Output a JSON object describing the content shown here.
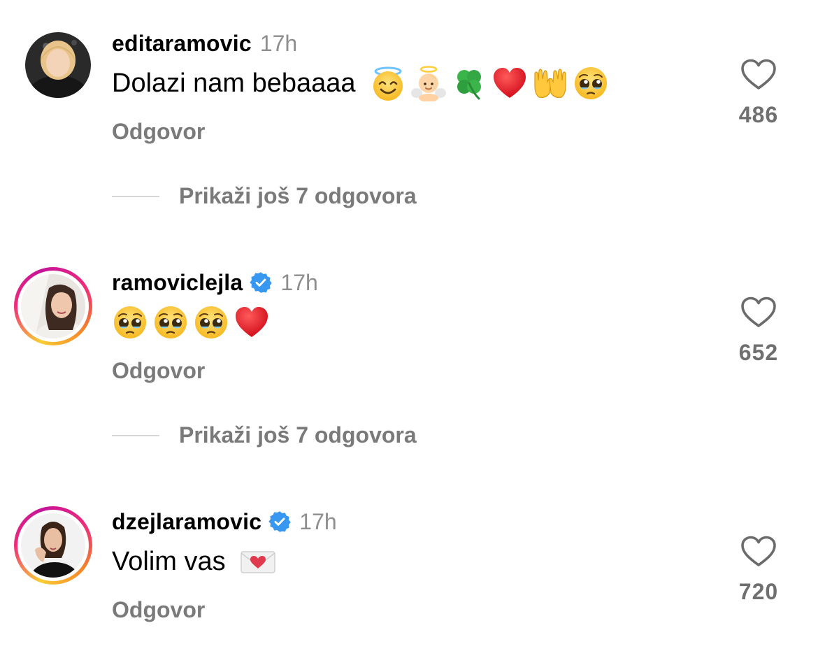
{
  "comments": [
    {
      "username": "editaramovic",
      "verified": false,
      "time": "17h",
      "text": "Dolazi nam bebaaaa",
      "emojis": [
        "smiling-face-with-halo",
        "baby-angel",
        "four-leaf-clover",
        "red-heart",
        "palms-up-together",
        "pleading-face"
      ],
      "reply_label": "Odgovor",
      "likes": "486",
      "more_replies": "Prikaži još 7 odgovora"
    },
    {
      "username": "ramoviclejla",
      "verified": true,
      "time": "17h",
      "text": "",
      "emojis": [
        "pleading-face",
        "pleading-face",
        "pleading-face",
        "red-heart"
      ],
      "reply_label": "Odgovor",
      "likes": "652",
      "more_replies": "Prikaži još 7 odgovora"
    },
    {
      "username": "dzejlaramovic",
      "verified": true,
      "time": "17h",
      "text": "Volim vas",
      "emojis": [
        "love-letter"
      ],
      "reply_label": "Odgovor",
      "likes": "720"
    }
  ],
  "colors": {
    "verified": "#3897f0",
    "muted": "#8e8e8e",
    "heart_red": "#e0202b",
    "emoji_yellow": "#ffc83d"
  }
}
